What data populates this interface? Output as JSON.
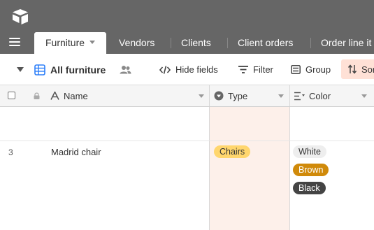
{
  "colors": {
    "topbar_bg": "#666666",
    "type_column_bg": "#fdf0ea",
    "sort_bg": "#ffe1d6",
    "view_icon": "#2d7ff9",
    "pill_chairs": "#ffd66e",
    "pill_white": "#eeeeee",
    "pill_brown": "#d08a0a",
    "pill_black": "#444444"
  },
  "app": {
    "logo_icon": "airtable-logo-icon"
  },
  "tabs": [
    {
      "label": "Furniture",
      "active": true
    },
    {
      "label": "Vendors"
    },
    {
      "label": "Clients"
    },
    {
      "label": "Client orders"
    },
    {
      "label": "Order line it"
    }
  ],
  "viewbar": {
    "view_name": "All furniture",
    "hide_fields": "Hide fields",
    "filter": "Filter",
    "group": "Group",
    "sort": "Sort"
  },
  "columns": {
    "name": "Name",
    "type": "Type",
    "color": "Color"
  },
  "rows": [
    {
      "number": "3",
      "name": "Madrid chair",
      "type": "Chairs",
      "colors": [
        "White",
        "Brown",
        "Black"
      ]
    }
  ]
}
